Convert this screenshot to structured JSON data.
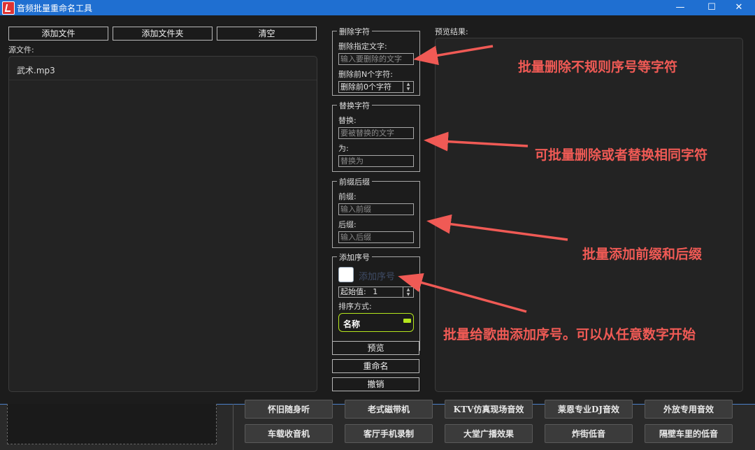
{
  "window": {
    "title": "音频批量重命名工具",
    "minimize_glyph": "—",
    "maximize_glyph": "☐",
    "close_glyph": "✕"
  },
  "toolbar": {
    "add_file": "添加文件",
    "add_folder": "添加文件夹",
    "clear": "清空"
  },
  "source": {
    "label": "源文件:",
    "files": [
      "武术.mp3"
    ]
  },
  "delete_group": {
    "title": "删除字符",
    "specified_label": "删除指定文字:",
    "specified_placeholder": "输入要删除的文字",
    "first_n_label": "删除前N个字符:",
    "first_n_value": "删除前0个字符"
  },
  "replace_group": {
    "title": "替换字符",
    "replace_label": "替换:",
    "replace_placeholder": "要被替换的文字",
    "with_label": "为:",
    "with_placeholder": "替换为"
  },
  "affix_group": {
    "title": "前缀后缀",
    "prefix_label": "前缀:",
    "prefix_placeholder": "输入前缀",
    "suffix_label": "后缀:",
    "suffix_placeholder": "输入后缀"
  },
  "serial_group": {
    "title": "添加序号",
    "checkbox_label": "添加序号",
    "checked": false,
    "start_label": "起始值:",
    "start_value": "1",
    "sort_label": "排序方式:",
    "sort_value": "名称"
  },
  "actions": {
    "preview": "预览",
    "rename": "重命名",
    "undo": "撤销"
  },
  "preview": {
    "label": "预览结果:"
  },
  "annotations": [
    "批量删除不规则序号等字符",
    "可批量删除或者替换相同字符",
    "批量添加前缀和后缀",
    "批量给歌曲添加序号。可以从任意数字开始"
  ],
  "effects": {
    "row1": [
      "怀旧随身听",
      "老式磁带机",
      "KTV仿真现场音效",
      "莱恩专业DJ音效",
      "外放专用音效"
    ],
    "row2": [
      "车载收音机",
      "客厅手机录制",
      "大堂广播效果",
      "炸街低音",
      "隔壁车里的低音"
    ]
  },
  "colors": {
    "titlebar": "#1f6fd1",
    "annotation": "#f05a55",
    "sort_accent": "#b5e61d"
  }
}
